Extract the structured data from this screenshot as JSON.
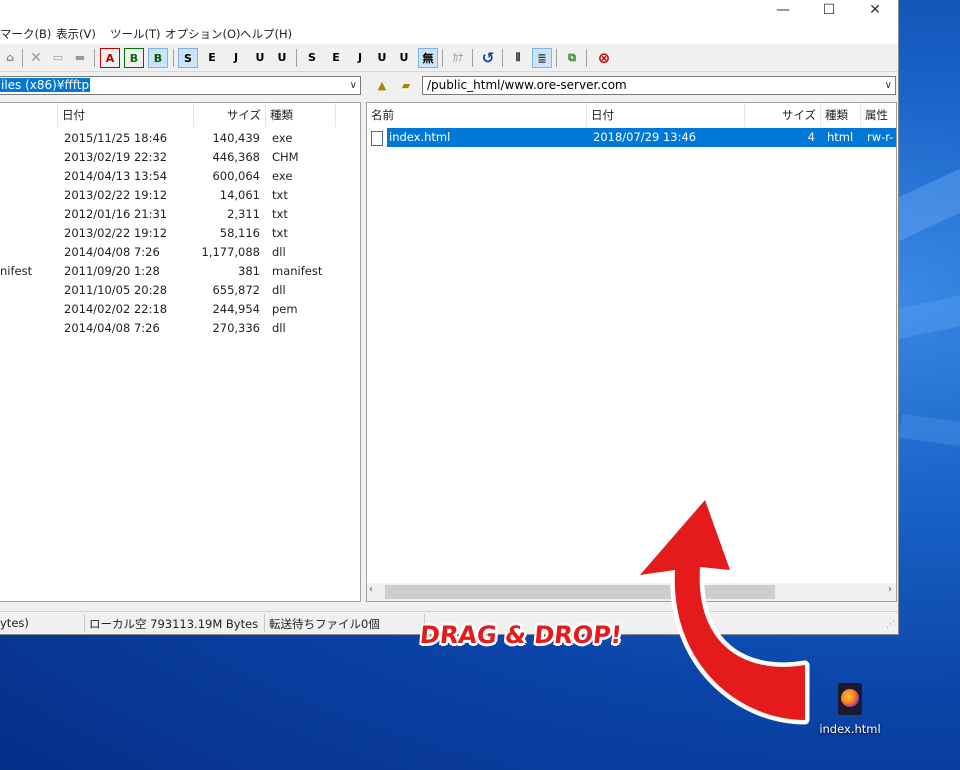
{
  "menu": [
    "マーク(B)",
    "表示(V)",
    "ツール(T)",
    "オプション(O)",
    "ヘルプ(H)"
  ],
  "window_buttons": {
    "minimize": "—",
    "maximize": "☐",
    "close": "✕"
  },
  "toolbar": {
    "items": [
      "A",
      "B",
      "B",
      "S",
      "E",
      "J",
      "U",
      "U",
      "S",
      "E",
      "J",
      "U",
      "U",
      "無",
      "ｶﾅ"
    ]
  },
  "local": {
    "path": "iles (x86)¥ffftp",
    "columns": {
      "date": "日付",
      "size": "サイズ",
      "type": "種類"
    },
    "rows": [
      {
        "name": "",
        "date": "2015/11/25 18:46",
        "size": "140,439",
        "type": "exe"
      },
      {
        "name": "",
        "date": "2013/02/19 22:32",
        "size": "446,368",
        "type": "CHM"
      },
      {
        "name": "",
        "date": "2014/04/13 13:54",
        "size": "600,064",
        "type": "exe"
      },
      {
        "name": "",
        "date": "2013/02/22 19:12",
        "size": "14,061",
        "type": "txt"
      },
      {
        "name": "",
        "date": "2012/01/16 21:31",
        "size": "2,311",
        "type": "txt"
      },
      {
        "name": "",
        "date": "2013/02/22 19:12",
        "size": "58,116",
        "type": "txt"
      },
      {
        "name": "",
        "date": "2014/04/08  7:26",
        "size": "1,177,088",
        "type": "dll"
      },
      {
        "name": "nifest",
        "date": "2011/09/20  1:28",
        "size": "381",
        "type": "manifest"
      },
      {
        "name": "",
        "date": "2011/10/05 20:28",
        "size": "655,872",
        "type": "dll"
      },
      {
        "name": "",
        "date": "2014/02/02 22:18",
        "size": "244,954",
        "type": "pem"
      },
      {
        "name": "",
        "date": "2014/04/08  7:26",
        "size": "270,336",
        "type": "dll"
      }
    ]
  },
  "remote": {
    "path": "/public_html/www.ore-server.com",
    "columns": {
      "name": "名前",
      "date": "日付",
      "size": "サイズ",
      "type": "種類",
      "attr": "属性"
    },
    "rows": [
      {
        "name": "index.html",
        "date": "2018/07/29 13:46",
        "size": "4",
        "type": "html",
        "attr": "rw-r-"
      }
    ]
  },
  "status": {
    "left": "ytes)",
    "local_free": "ローカル空 793113.19M Bytes",
    "queue": "転送待ちファイル0個"
  },
  "caption": "DRAG & DROP!",
  "desktop_icon": {
    "label": "index.html"
  },
  "colors": {
    "selection": "#0078d7",
    "arrow": "#e51b1b"
  }
}
